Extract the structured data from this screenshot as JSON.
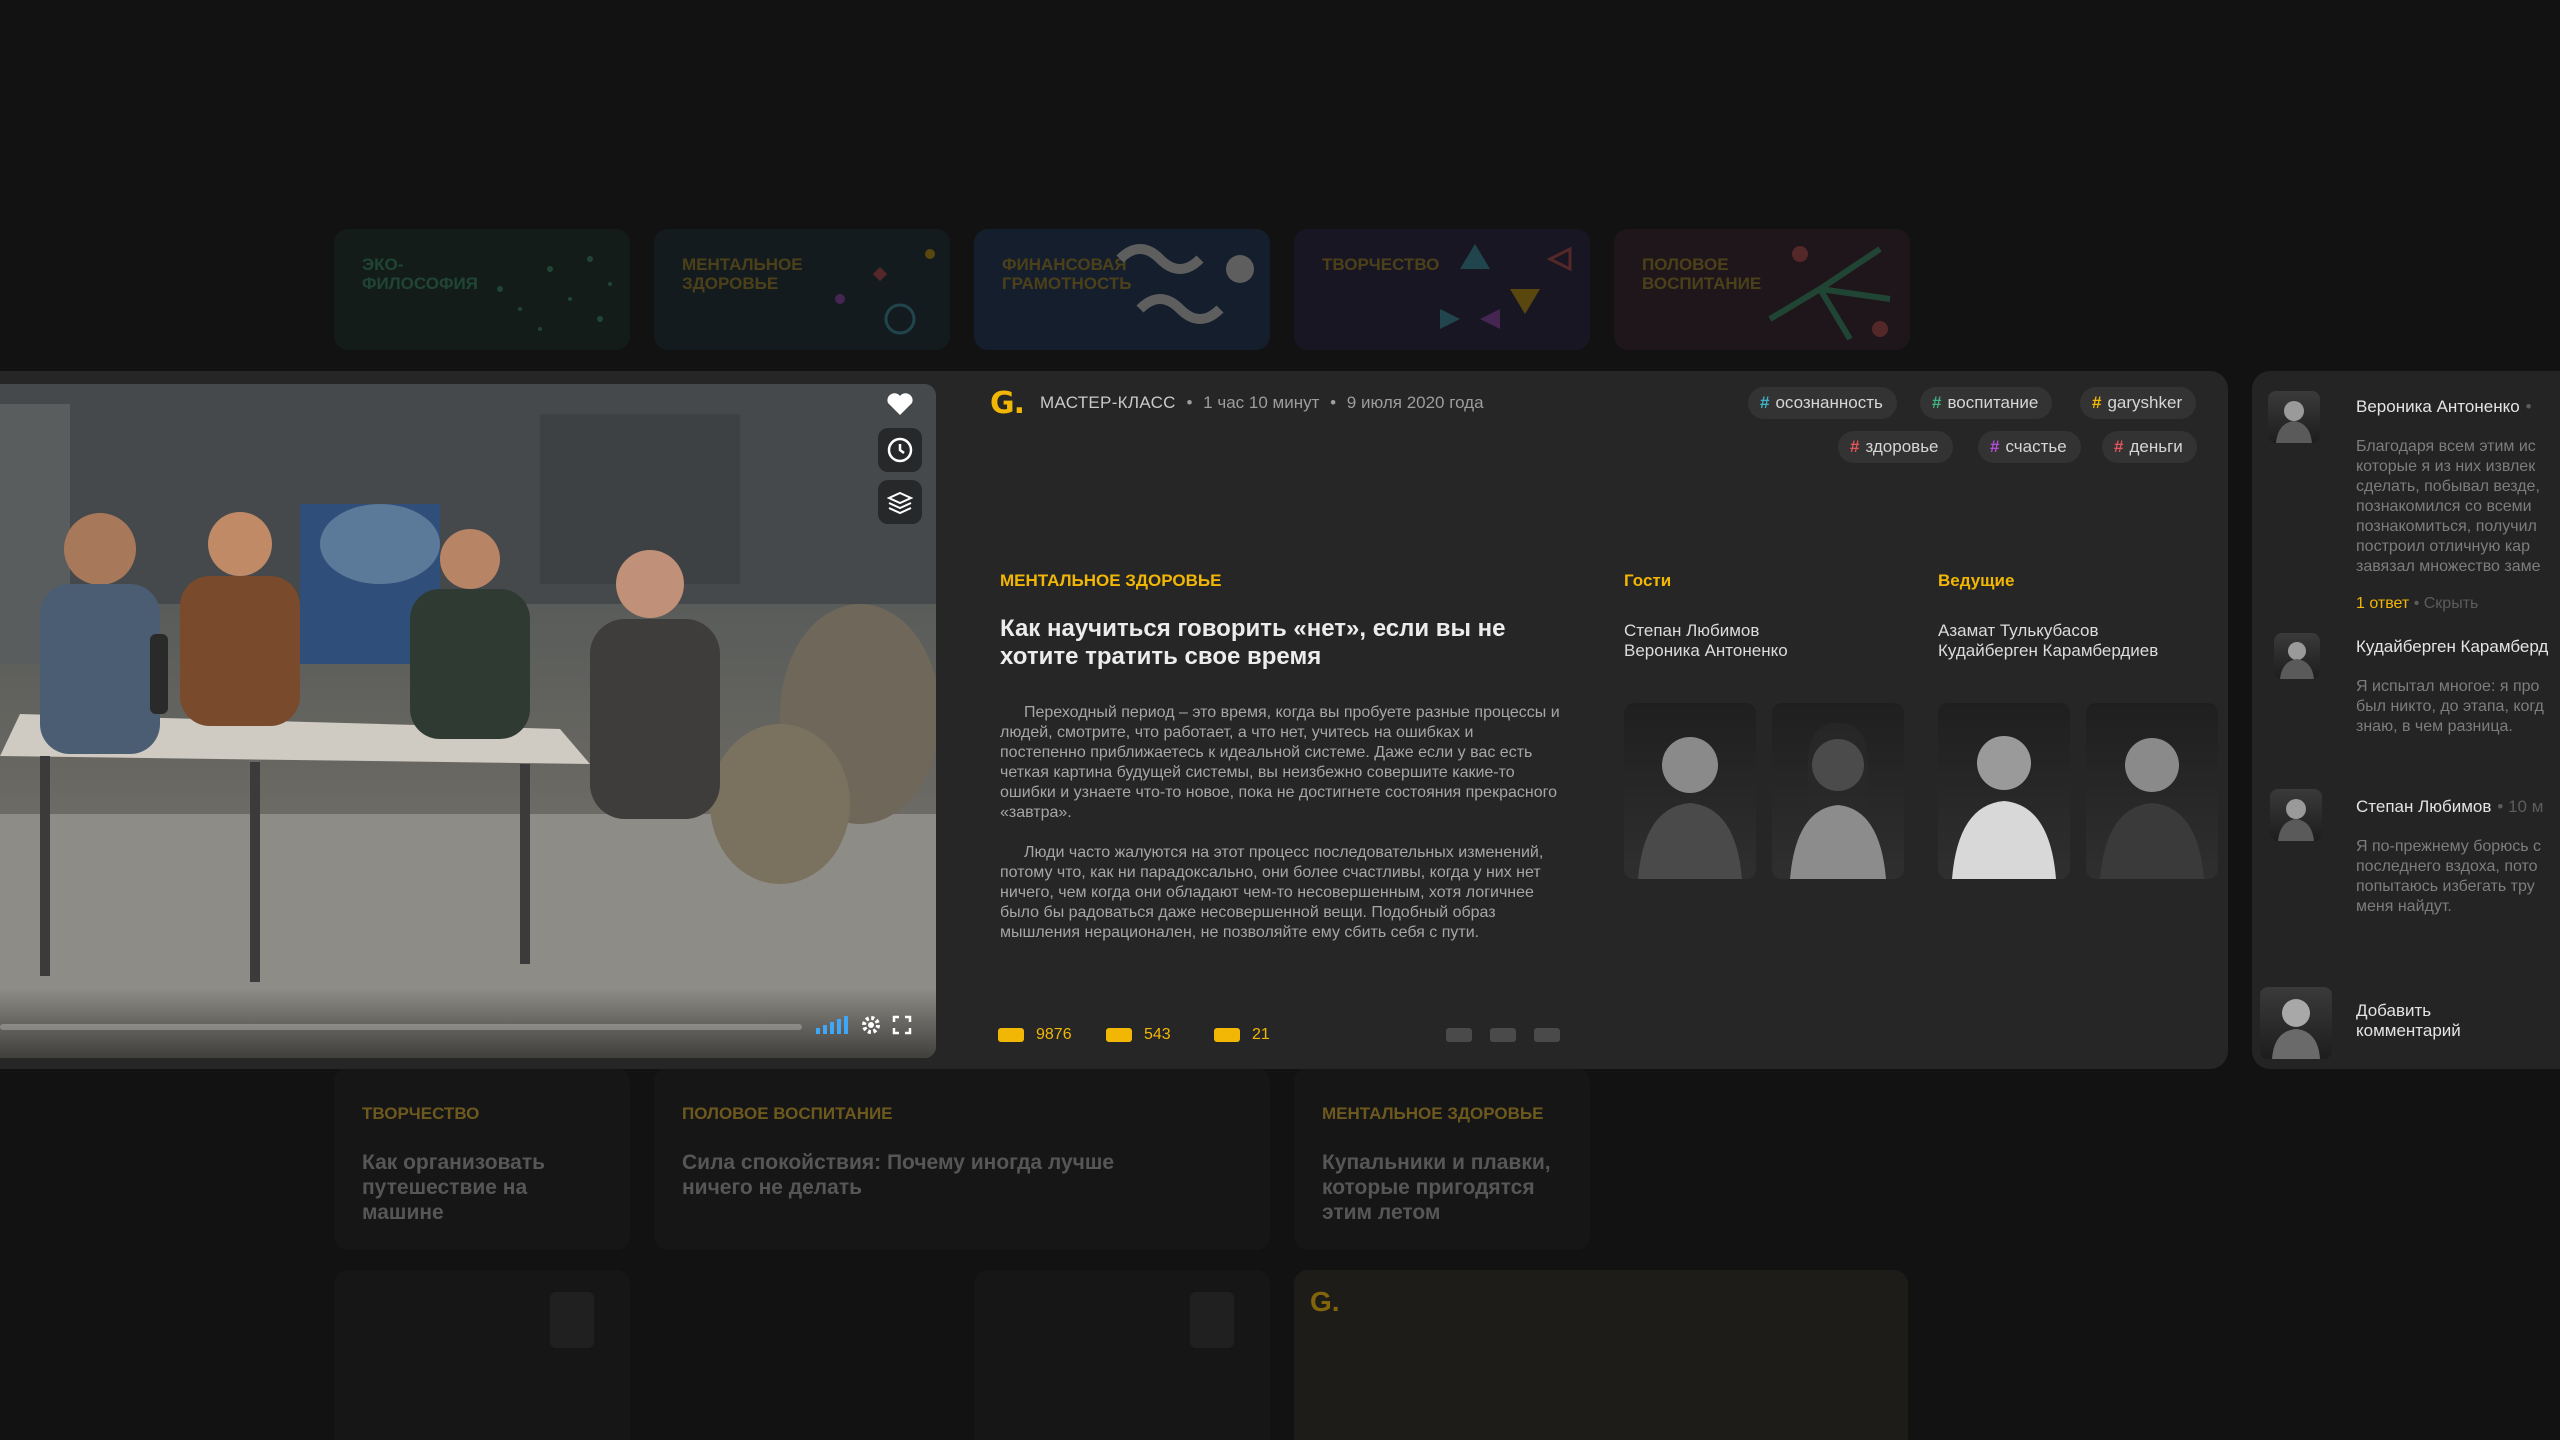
{
  "categories": [
    {
      "label": "ЭКО-ФИЛОСОФИЯ",
      "bg": "#173328",
      "text": "#3fb27f"
    },
    {
      "label": "МЕНТАЛЬНОЕ ЗДОРОВЬЕ",
      "bg": "#16303a",
      "text": "#c7a02a"
    },
    {
      "label": "ФИНАНСОВАЯ ГРАМОТНОСТЬ",
      "bg": "#1c3a66",
      "text": "#c7a02a"
    },
    {
      "label": "ТВОРЧЕСТВО",
      "bg": "#2a1f4a",
      "text": "#c7a02a"
    },
    {
      "label": "ПОЛОВОЕ ВОСПИТАНИЕ",
      "bg": "#3a1f2b",
      "text": "#c7a02a"
    }
  ],
  "colors": {
    "accent": "#f2b705",
    "card": "#262626",
    "background": "#121212"
  },
  "video": {
    "controls": [
      "signal-icon",
      "gear-icon",
      "fullscreen-icon"
    ],
    "side_buttons": [
      "heart-icon",
      "clock-icon",
      "layers-icon"
    ]
  },
  "meta": {
    "logo": "G.",
    "type": "МАСТЕР-КЛАСС",
    "duration": "1 час 10 минут",
    "date": "9 июля 2020 года",
    "separator": "•"
  },
  "tags": [
    {
      "label": "осознанность",
      "color": "#3fb2c7"
    },
    {
      "label": "воспитание",
      "color": "#3fb27f"
    },
    {
      "label": "garyshker",
      "color": "#f2b705"
    },
    {
      "label": "здоровье",
      "color": "#e0555a"
    },
    {
      "label": "счастье",
      "color": "#b04fd6"
    },
    {
      "label": "деньги",
      "color": "#e0555a"
    }
  ],
  "article": {
    "category": "МЕНТАЛЬНОЕ ЗДОРОВЬЕ",
    "title": "Как научиться говорить «нет», если вы не хотите тратить свое время",
    "paragraphs": [
      "Переходный период – это время, когда вы пробуете разные процессы и людей, смотрите, что работает, а что нет, учитесь на ошибках и постепенно приближаетесь к идеальной системе. Даже если у вас есть четкая картина будущей системы, вы неизбежно совершите какие-то ошибки и узнаете что-то новое, пока не достигнете состояния прекрасного «завтра».",
      "Люди часто жалуются на этот процесс последовательных изменений, потому что, как ни парадоксально, они более счастливы, когда у них нет ничего, чем когда они обладают чем-то несовершенным, хотя логичнее было бы радоваться даже несовершенной вещи. Подобный образ мышления нерационален, не позволяйте ему сбить себя с пути."
    ]
  },
  "guests": {
    "label": "Гости",
    "names": [
      "Степан Любимов",
      "Вероника Антоненко"
    ]
  },
  "hosts": {
    "label": "Ведущие",
    "names": [
      "Азамат Тулькубасов",
      "Кудайберген Карамбердиев"
    ]
  },
  "stats": [
    "9876",
    "543",
    "21"
  ],
  "comments": [
    {
      "name": "Вероника Антоненко",
      "time": "•",
      "text": "Благодаря всем этим ис\nкоторые я из них извлек\nсделать, побывал везде,\nпознакомился со всеми\nпознакомиться, получил\nпостроил отличную кар\nзавязал множество заме",
      "replies": "1 ответ",
      "hide": "• Скрыть"
    },
    {
      "name": "Кудайберген Карамберд",
      "text": "Я испытал многое: я про\nбыл никто, до этапа, когд\nзнаю, в чем разница."
    },
    {
      "name": "Степан Любимов",
      "time": "• 10 м",
      "text": "Я по-прежнему борюсь с\nпоследнего вздоха, пото\nпопытаюсь избегать тру\nменя найдут."
    }
  ],
  "add_comment": {
    "label": "Добавить комментарий"
  },
  "background_cards": [
    {
      "category": "ТВОРЧЕСТВО",
      "title": "Как организовать путешествие на машине"
    },
    {
      "category": "ПОЛОВОЕ ВОСПИТАНИЕ",
      "title": "Сила спокойствия: Почему иногда лучше ничего не делать"
    },
    {
      "category": "МЕНТАЛЬНОЕ ЗДОРОВЬЕ",
      "title": "Купальники и плавки, которые пригодятся этим летом"
    }
  ],
  "bottom_logo": "G."
}
